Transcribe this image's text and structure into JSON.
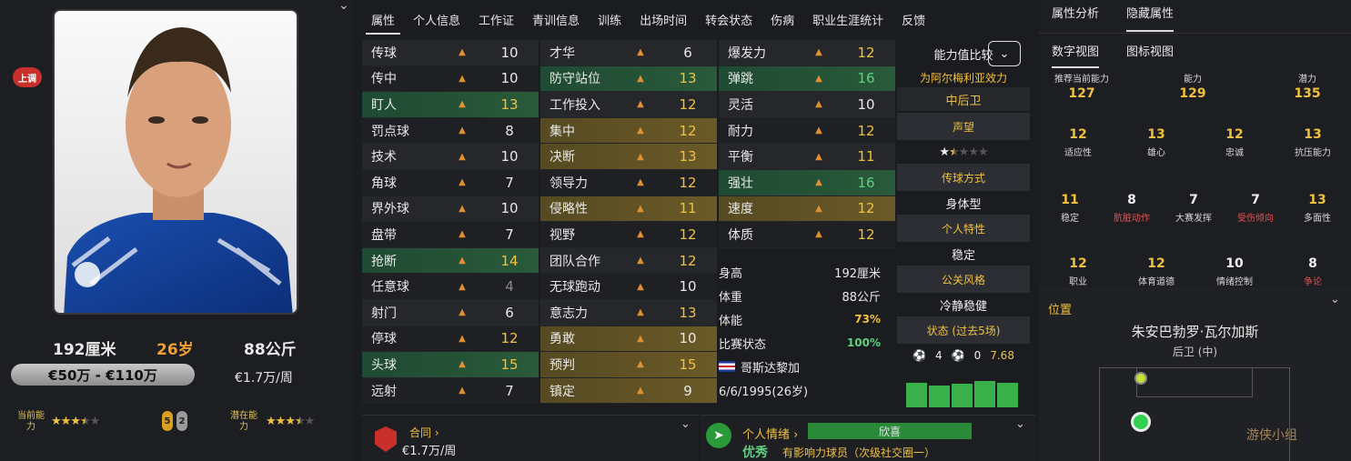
{
  "player": {
    "loan_badge": "上调",
    "height": "192厘米",
    "age": "26岁",
    "weight": "88公斤",
    "value": "€50万 - €110万",
    "wage": "€1.7万/周",
    "ca_label": "当前能力",
    "pa_label": "潜在能力",
    "ca_stars": 3.5,
    "pa_stars": 3.5,
    "rating_a": "5",
    "rating_b": "2"
  },
  "tabs": [
    "属性",
    "个人信息",
    "工作证",
    "青训信息",
    "训练",
    "出场时间",
    "转会状态",
    "伤病",
    "职业生涯统计",
    "反馈"
  ],
  "attributes": {
    "technical": [
      {
        "name": "传球",
        "value": "10",
        "style": "even"
      },
      {
        "name": "传中",
        "value": "10",
        "style": "odd"
      },
      {
        "name": "盯人",
        "value": "13",
        "style": "green",
        "color": "y"
      },
      {
        "name": "罚点球",
        "value": "8",
        "style": "odd"
      },
      {
        "name": "技术",
        "value": "10",
        "style": "even"
      },
      {
        "name": "角球",
        "value": "7",
        "style": "odd"
      },
      {
        "name": "界外球",
        "value": "10",
        "style": "even"
      },
      {
        "name": "盘带",
        "value": "7",
        "style": "odd"
      },
      {
        "name": "抢断",
        "value": "14",
        "style": "green",
        "color": "y"
      },
      {
        "name": "任意球",
        "value": "4",
        "style": "odd",
        "color": "grey"
      },
      {
        "name": "射门",
        "value": "6",
        "style": "even"
      },
      {
        "name": "停球",
        "value": "12",
        "style": "odd",
        "color": "y"
      },
      {
        "name": "头球",
        "value": "15",
        "style": "green",
        "color": "y"
      },
      {
        "name": "远射",
        "value": "7",
        "style": "odd"
      }
    ],
    "mental": [
      {
        "name": "才华",
        "value": "6",
        "style": "even"
      },
      {
        "name": "防守站位",
        "value": "13",
        "style": "green",
        "color": "y"
      },
      {
        "name": "工作投入",
        "value": "12",
        "style": "even",
        "color": "y"
      },
      {
        "name": "集中",
        "value": "12",
        "style": "gold",
        "color": "y"
      },
      {
        "name": "决断",
        "value": "13",
        "style": "gold",
        "color": "y"
      },
      {
        "name": "领导力",
        "value": "12",
        "style": "odd",
        "color": "y"
      },
      {
        "name": "侵略性",
        "value": "11",
        "style": "gold",
        "color": "y"
      },
      {
        "name": "视野",
        "value": "12",
        "style": "odd",
        "color": "y"
      },
      {
        "name": "团队合作",
        "value": "12",
        "style": "even",
        "color": "y"
      },
      {
        "name": "无球跑动",
        "value": "10",
        "style": "odd"
      },
      {
        "name": "意志力",
        "value": "13",
        "style": "even",
        "color": "y"
      },
      {
        "name": "勇敢",
        "value": "10",
        "style": "gold"
      },
      {
        "name": "预判",
        "value": "15",
        "style": "gold",
        "color": "y"
      },
      {
        "name": "镇定",
        "value": "9",
        "style": "gold"
      }
    ],
    "physical": [
      {
        "name": "爆发力",
        "value": "12",
        "style": "even",
        "color": "y"
      },
      {
        "name": "弹跳",
        "value": "16",
        "style": "green",
        "color": "g"
      },
      {
        "name": "灵活",
        "value": "10",
        "style": "even"
      },
      {
        "name": "耐力",
        "value": "12",
        "style": "odd",
        "color": "y"
      },
      {
        "name": "平衡",
        "value": "11",
        "style": "even",
        "color": "y"
      },
      {
        "name": "强壮",
        "value": "16",
        "style": "green",
        "color": "g"
      },
      {
        "name": "速度",
        "value": "12",
        "style": "gold",
        "color": "y"
      },
      {
        "name": "体质",
        "value": "12",
        "style": "odd",
        "color": "y"
      }
    ]
  },
  "bio": {
    "height_label": "身高",
    "height": "192厘米",
    "weight_label": "体重",
    "weight": "88公斤",
    "fitness_label": "体能",
    "fitness": "73%",
    "match_label": "比赛状态",
    "match": "100%",
    "nation": "哥斯达黎加",
    "dob": "6/6/1995(26岁)"
  },
  "compare": {
    "head": "能力值比较",
    "plays_for": "为阿尔梅利亚效力",
    "position": "中后卫",
    "rep_title": "声望",
    "rep_stars": 1.5,
    "style_title": "传球方式",
    "style_val": "身体型",
    "trait_title": "个人特性",
    "trait_val": "稳定",
    "pr_title": "公关风格",
    "pr_val": "冷静稳健",
    "form_title": "状态 (过去5场)",
    "goals": "4",
    "assists": "0",
    "avg": "7.68",
    "form_bars": [
      0.62,
      0.55,
      0.58,
      0.65,
      0.62
    ]
  },
  "contract": {
    "title": "合同",
    "value": "€1.7万/周"
  },
  "morale": {
    "title": "个人情绪",
    "mood": "欣喜",
    "level": "优秀",
    "desc": "有影响力球员（次级社交圈一）"
  },
  "right": {
    "tab1": "属性分析",
    "tab2": "隐藏属性",
    "view1": "数字视图",
    "view2": "图标视图",
    "rec_label": "推荐当前能力",
    "rec": "127",
    "ca_label": "能力",
    "ca": "129",
    "pa_label": "潜力",
    "pa": "135",
    "hidden": [
      {
        "v": "12",
        "l": "适应性"
      },
      {
        "v": "13",
        "l": "雄心"
      },
      {
        "v": "12",
        "l": "忠诚"
      },
      {
        "v": "13",
        "l": "抗压能力"
      },
      {
        "v": "11",
        "l": "稳定"
      },
      {
        "v": "8",
        "l": "肮脏动作",
        "red": true,
        "white": true
      },
      {
        "v": "7",
        "l": "大赛发挥",
        "white": true
      },
      {
        "v": "7",
        "l": "受伤倾向",
        "red": true,
        "white": true
      },
      {
        "v": "13",
        "l": "多面性"
      },
      {
        "v": "12",
        "l": "职业"
      },
      {
        "v": "12",
        "l": "体育道德"
      },
      {
        "v": "10",
        "l": "情绪控制",
        "white": true
      },
      {
        "v": "8",
        "l": "争论",
        "red": true,
        "white": true
      }
    ],
    "pos_title": "位置",
    "name": "朱安巴勃罗·瓦尔加斯",
    "pos": "后卫 (中)",
    "watermark": "游侠小组"
  }
}
